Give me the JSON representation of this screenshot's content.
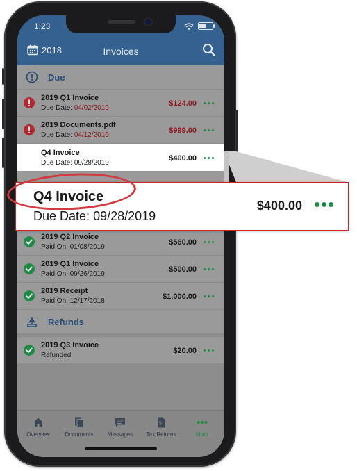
{
  "status_bar": {
    "time": "1:23"
  },
  "header": {
    "year": "2018",
    "title": "Invoices"
  },
  "sections": {
    "due": "Due",
    "refunds": "Refunds"
  },
  "due_items": [
    {
      "title": "2019 Q1 Invoice",
      "sub_label": "Due Date:",
      "sub_value": "04/02/2019",
      "amount": "$124.00",
      "status": "alert"
    },
    {
      "title": "2019 Documents.pdf",
      "sub_label": "Due Date:",
      "sub_value": "04/12/2019",
      "amount": "$999.00",
      "status": "alert"
    },
    {
      "title": "Q4 Invoice",
      "sub_label": "Due Date:",
      "sub_value": "09/28/2019",
      "amount": "$400.00",
      "status": "none"
    }
  ],
  "paid_items": [
    {
      "title": "2019 Q2 Invoice",
      "sub_label": "Paid On:",
      "sub_value": "01/08/2019",
      "amount": "$560.00"
    },
    {
      "title": "2019 Q1 Invoice",
      "sub_label": "Paid On:",
      "sub_value": "09/26/2019",
      "amount": "$500.00"
    },
    {
      "title": "2019 Receipt",
      "sub_label": "Paid On:",
      "sub_value": "12/17/2018",
      "amount": "$1,000.00"
    }
  ],
  "refund_items": [
    {
      "title": "2019 Q3 Invoice",
      "sub": "Refunded",
      "amount": "$20.00"
    }
  ],
  "zoom": {
    "title": "Q4 Invoice",
    "sub_label": "Due Date:",
    "sub_value": "09/28/2019",
    "amount": "$400.00"
  },
  "tabs": [
    {
      "label": "Overview",
      "icon": "home-icon"
    },
    {
      "label": "Documents",
      "icon": "documents-icon"
    },
    {
      "label": "Messages",
      "icon": "message-icon"
    },
    {
      "label": "Tax Returns",
      "icon": "tax-return-icon"
    },
    {
      "label": "More",
      "icon": "more-icon"
    }
  ],
  "colors": {
    "header": "#34618f",
    "accent_green": "#1f8a45",
    "alert_red": "#b3262d",
    "callout_red": "#d23a3f"
  }
}
